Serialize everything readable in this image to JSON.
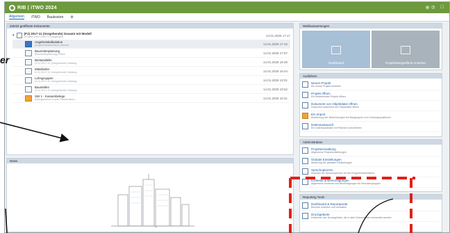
{
  "app": {
    "title": "RIB | iTWO 2024",
    "titlebar_icons": [
      "⊕ ⑦",
      "□"
    ]
  },
  "menubar": {
    "tabs": [
      "Allgemein",
      "iTWO",
      "Baukosten",
      "⚙"
    ]
  },
  "docs_panel": {
    "header": "Zuletzt geöffnete Dokumente",
    "project": {
      "label": "(PJ) 2017-11 (Vorgehende) Gesamt mit Modell",
      "sub": "(Projekt 2022-00017) (Vorgänger)",
      "date": "14.01.2025 17:17"
    },
    "rows": [
      {
        "title": "Angebotskalkulation",
        "sub": "(Angebotskalkulation) Bauteil",
        "date": "14.01.2025 17:15",
        "icon": "blue"
      },
      {
        "title": "Bauzeitenplanung",
        "sub": "(Bauzeitenplanung) Pläne",
        "date": "14.01.2025 17:07",
        "icon": "white"
      },
      {
        "title": "Bestandteile",
        "sub": "(2.0) 2017-11 (Vorgehende) Katalog",
        "date": "14.01.2025 16:48",
        "icon": "white"
      },
      {
        "title": "Mitarbeiter",
        "sub": "(2.0) 2017-11 (Vorgehende) Katalog",
        "date": "14.01.2025 16:44",
        "icon": "white"
      },
      {
        "title": "Lohngruppen",
        "sub": "(2.0) 2017-11 (Vorgehende) Katalog",
        "date": "14.01.2025 13:01",
        "icon": "white"
      },
      {
        "title": "Baustellen",
        "sub": "(2.0) 2017-11 (Vorgehende) Katalog",
        "date": "14.01.2025 10:52",
        "icon": "white"
      },
      {
        "title": "SW 1 - Kassenbelege",
        "sub": "(Belegwesen) Export Stammdaten",
        "date": "14.01.2025 10:41",
        "icon": "org"
      }
    ]
  },
  "news_panel": {
    "header": "News"
  },
  "tiles_panel": {
    "header": "Wahlauswertungen",
    "tiles": [
      {
        "label": "Dashboard"
      },
      {
        "label": "Projektübergreifend Ansehen"
      }
    ]
  },
  "apps_panel": {
    "header": "Ausführen",
    "items": [
      {
        "title": "Neues Projekt",
        "sub": "Ein neues Projekt erstellen",
        "icon": "blue"
      },
      {
        "title": "Projekt öffnen",
        "sub": "Ein bestehendes Projekt öffnen",
        "icon": "blue"
      },
      {
        "title": "Dokument von Objektdatei öffnen",
        "sub": "Dokument basierend auf Objektdatei öffnen",
        "icon": "blue"
      },
      {
        "title": "Ein Import",
        "sub": "Ausführung der Berechnungen bei Baugruppen und Leistungspositionen",
        "icon": "org"
      },
      {
        "title": "Datenaustausch",
        "sub": "Ein Datenaustausch mit Partnern durchführen",
        "icon": "blue"
      }
    ]
  },
  "admin_panel": {
    "header": "Administration",
    "items": [
      {
        "title": "Projektverwaltung",
        "sub": "Allgemeine Projekteinstellungen"
      },
      {
        "title": "Globale Einstellungen",
        "sub": "Änderung der globalen Einstellungen"
      },
      {
        "title": "Sprachoptionen",
        "sub": "Auswahl der Sprachoptionen für die Programmoberfläche"
      },
      {
        "title": "Kontexte & Berechtigungen",
        "sub": "Allgemeine Kontexte und Berechtigungen für Benutzergruppen"
      }
    ]
  },
  "reports_panel": {
    "header": "Reporting Tools",
    "items": [
      {
        "title": "Dashboard & Reportportal",
        "sub": "Berichte erstellen und verwalten"
      },
      {
        "title": "Druckgebiete",
        "sub": "Definieren der Druckgebiete, die in allen Dokumenten verwendet werden"
      }
    ]
  },
  "annotation": {
    "text": "er"
  }
}
